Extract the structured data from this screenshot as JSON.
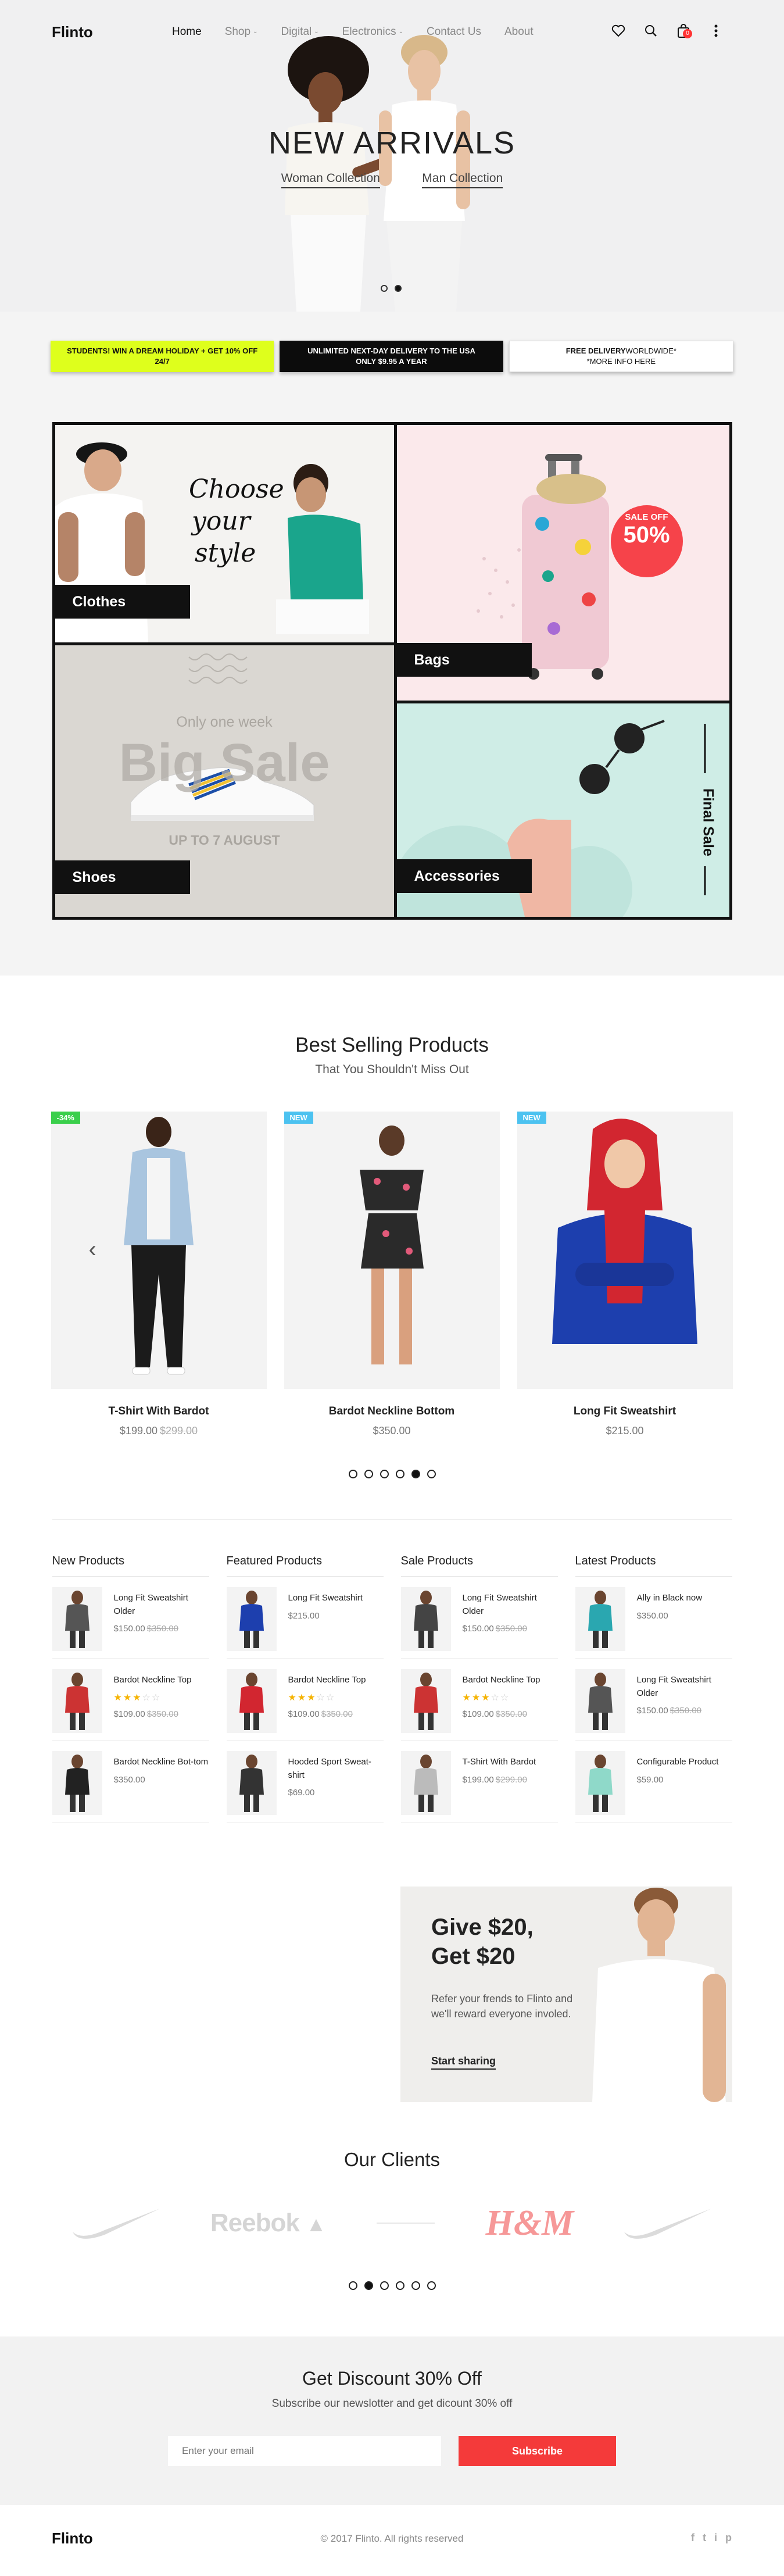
{
  "header": {
    "logo": "Flinto",
    "nav": [
      {
        "label": "Home"
      },
      {
        "label": "Shop"
      },
      {
        "label": "Digital"
      },
      {
        "label": "Electronics"
      },
      {
        "label": "Contact Us"
      },
      {
        "label": "About"
      }
    ],
    "cart_count": "0"
  },
  "hero": {
    "title": "NEW ARRIVALS",
    "link_woman": "Woman Collection",
    "link_man": "Man Collection"
  },
  "promo": {
    "p1": "STUDENTS! WIN A DREAM HOLIDAY + GET 10% OFF 24/7",
    "p2_line1": "UNLIMITED NEXT-DAY DELIVERY TO THE USA",
    "p2_line2a": "ONLY",
    "p2_price": "$9.95",
    "p2_line2b": "A YEAR",
    "p3_bold": "FREE DELIVERY",
    "p3_rest": "WORLDWIDE*",
    "p3_line2": "*MORE INFO HERE"
  },
  "categories": {
    "clothes": "Clothes",
    "clothes_script": [
      "Choose",
      "your",
      "style"
    ],
    "bags": "Bags",
    "bags_sale_top": "SALE OFF",
    "bags_sale_pct": "50%",
    "shoes": "Shoes",
    "shoes_top": "Only one week",
    "shoes_big": "Big Sale",
    "shoes_bottom": "UP TO 7 AUGUST",
    "accessories": "Accessories",
    "acc_side": "Final Sale"
  },
  "best": {
    "title": "Best Selling Products",
    "subtitle": "That You Shouldn't Miss Out",
    "products": [
      {
        "name": "T-Shirt With Bardot",
        "price": "$199.00",
        "old": "$299.00",
        "badge": "-34%"
      },
      {
        "name": "Bardot Neckline Bottom",
        "price": "$350.00",
        "old": "",
        "badge": "NEW"
      },
      {
        "name": "Long Fit Sweatshirt",
        "price": "$215.00",
        "old": "",
        "badge": "NEW"
      }
    ]
  },
  "lists": [
    {
      "title": "New Products",
      "items": [
        {
          "name": "Long Fit Sweatshirt Older",
          "price": "$150.00",
          "old": "$350.00"
        },
        {
          "name": "Bardot Neckline Top",
          "price": "$109.00",
          "old": "$350.00",
          "stars": 3
        },
        {
          "name": "Bardot Neckline Bot-tom",
          "price": "$350.00",
          "old": ""
        }
      ]
    },
    {
      "title": "Featured Products",
      "items": [
        {
          "name": "Long Fit Sweatshirt",
          "price": "$215.00",
          "old": ""
        },
        {
          "name": "Bardot Neckline Top",
          "price": "$109.00",
          "old": "$350.00",
          "stars": 3
        },
        {
          "name": "Hooded Sport Sweat-shirt",
          "price": "$69.00",
          "old": ""
        }
      ]
    },
    {
      "title": "Sale Products",
      "items": [
        {
          "name": "Long Fit Sweatshirt Older",
          "price": "$150.00",
          "old": "$350.00"
        },
        {
          "name": "Bardot Neckline Top",
          "price": "$109.00",
          "old": "$350.00",
          "stars": 3
        },
        {
          "name": "T-Shirt With Bardot",
          "price": "$199.00",
          "old": "$299.00"
        }
      ]
    },
    {
      "title": "Latest Products",
      "items": [
        {
          "name": "Ally in Black now",
          "price": "$350.00",
          "old": ""
        },
        {
          "name": "Long Fit Sweatshirt Older",
          "price": "$150.00",
          "old": "$350.00"
        },
        {
          "name": "Configurable Product",
          "price": "$59.00",
          "old": ""
        }
      ]
    }
  ],
  "give": {
    "title": "Give $20, Get $20",
    "text": "Refer your frends to Flinto and we'll reward everyone involed.",
    "link": "Start sharing"
  },
  "clients": {
    "title": "Our Clients",
    "reebok": "Reebok",
    "hm": "H&M"
  },
  "discount": {
    "title": "Get Discount 30% Off",
    "subtitle": "Subscribe our newslotter and get dicount 30% off",
    "placeholder": "Enter your email",
    "button": "Subscribe"
  },
  "footer": {
    "logo": "Flinto",
    "copy": "© 2017 Flinto. All rights reserved",
    "social": [
      "f",
      "t",
      "i",
      "p"
    ]
  },
  "colors": {
    "accent": "#f43a3a",
    "promo_yellow": "#deff1c",
    "badge_green": "#3acf4b",
    "badge_blue": "#4cc2f0"
  }
}
